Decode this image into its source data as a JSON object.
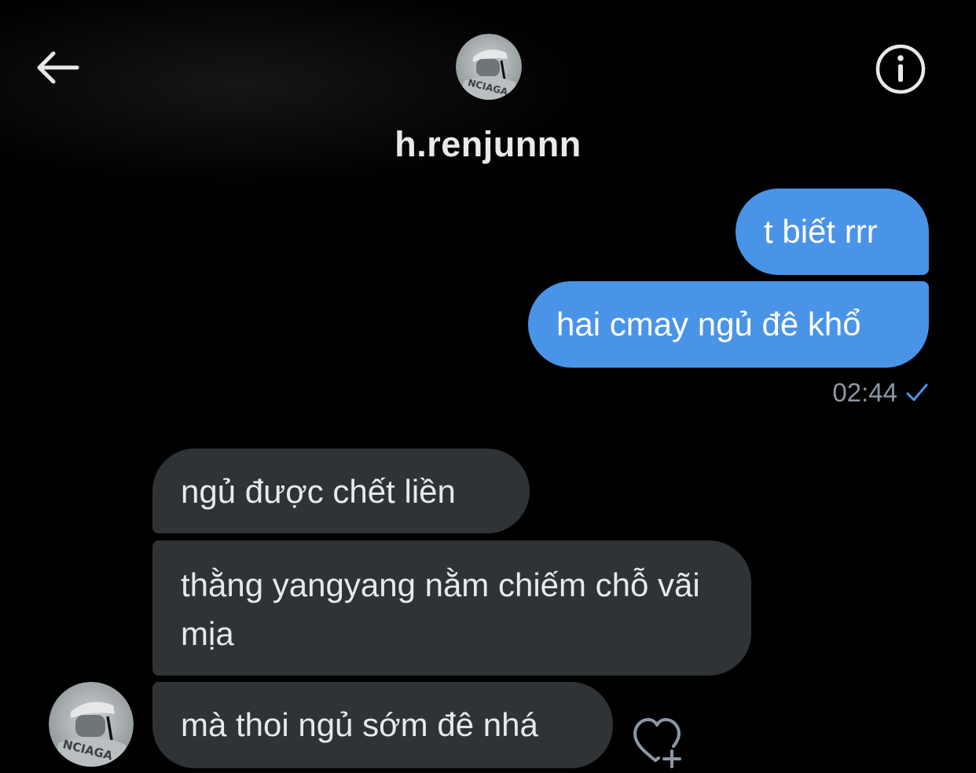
{
  "header": {
    "username": "h.renjunnn",
    "back_icon": "arrow-left-icon",
    "info_icon": "info-circle-icon",
    "avatar_text": "NCIAGA"
  },
  "messages": {
    "sent": [
      {
        "text": "t biết rrr"
      },
      {
        "text": "hai cmay ngủ đê khổ"
      }
    ],
    "sent_time": "02:44",
    "sent_status_icon": "checkmark-icon",
    "received": [
      {
        "text": "ngủ được chết liền"
      },
      {
        "text": "thằng yangyang nằm chiếm chỗ vãi mịa"
      },
      {
        "text": "mà thoi ngủ sớm đê nhá"
      }
    ],
    "react_icon": "heart-add-icon"
  },
  "colors": {
    "background": "#000000",
    "sent_bubble": "#4a94e8",
    "received_bubble": "#2f3336",
    "text_primary": "#e7e9ea",
    "timestamp": "#8b98a5",
    "check": "#4a94e8"
  }
}
